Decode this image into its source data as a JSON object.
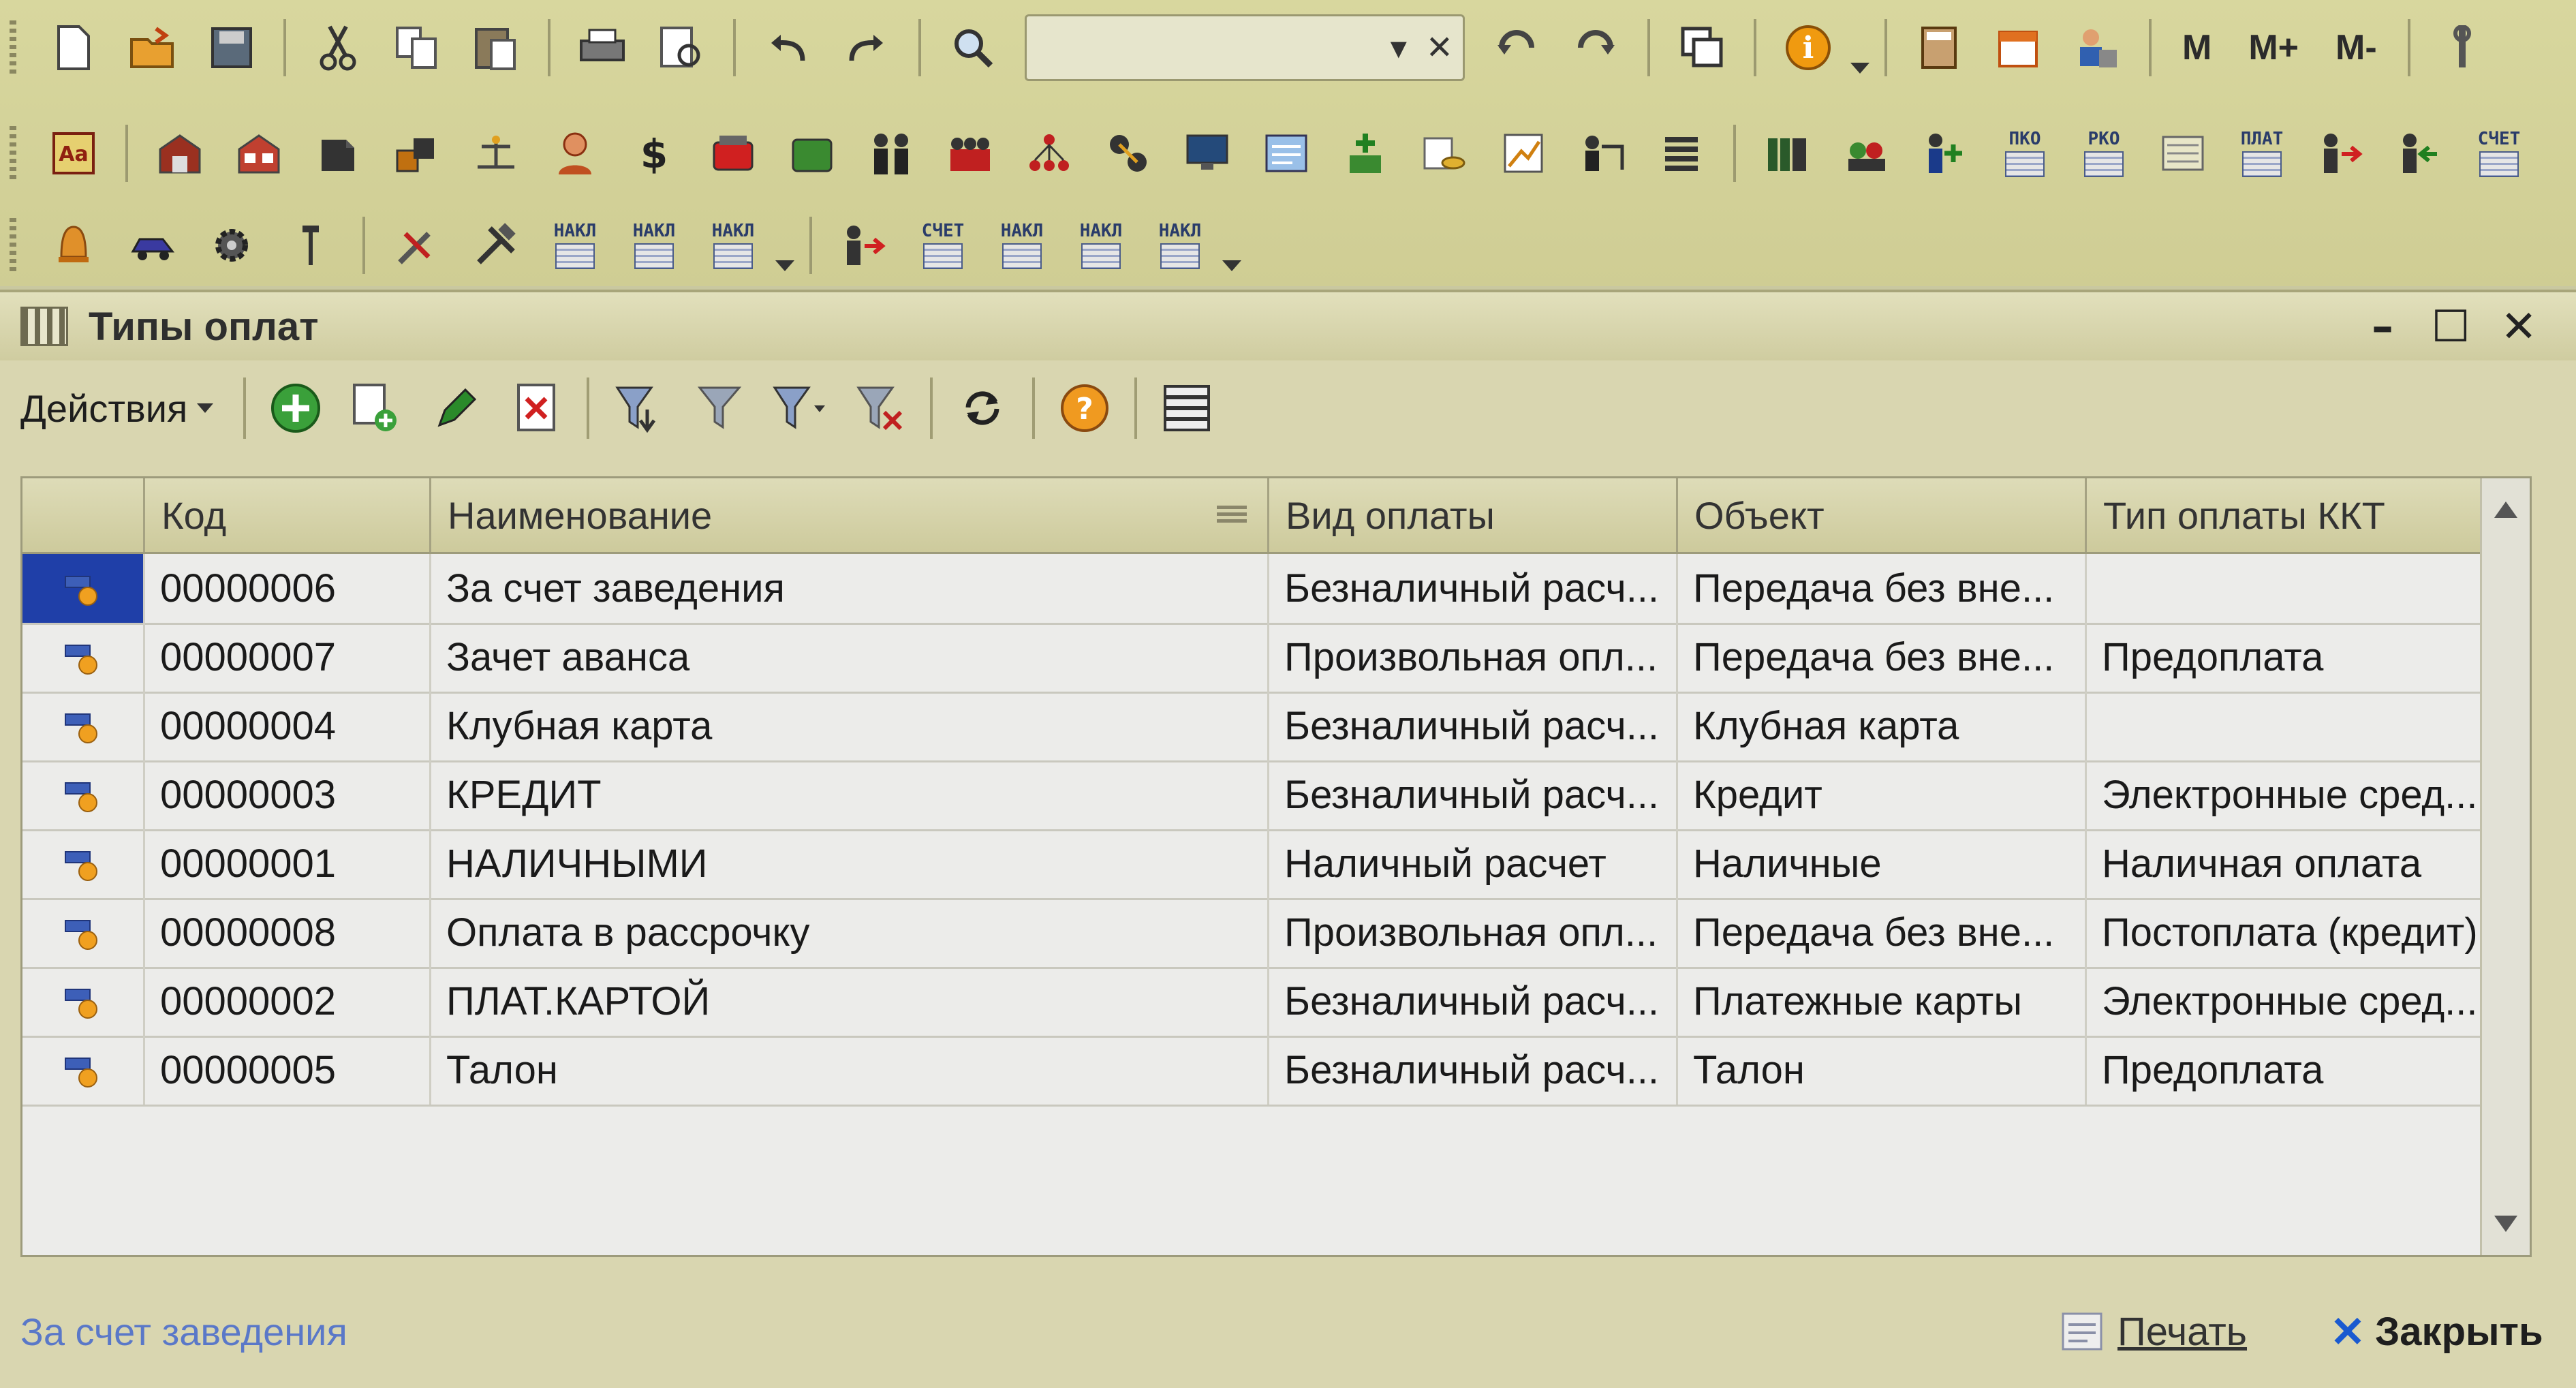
{
  "top_toolbar": {
    "row1": [
      "new-document",
      "open",
      "save",
      "cut",
      "copy",
      "paste",
      "print",
      "print-preview",
      "undo",
      "redo",
      "search",
      "history-back",
      "history-forward",
      "windows",
      "info",
      "calculator",
      "calendar",
      "users"
    ],
    "row1_text_buttons": [
      "M",
      "M+",
      "M-"
    ],
    "row2_small_labels": [
      "ПКО",
      "РКО",
      "ПЛАТ",
      "СЧЕТ"
    ],
    "row3_small_labels": [
      "НАКЛ",
      "НАКЛ",
      "НАКЛ",
      "СЧЕТ",
      "НАКЛ",
      "НАКЛ",
      "НАКЛ"
    ],
    "search_value": ""
  },
  "window": {
    "title": "Типы оплат",
    "actions_label": "Действия"
  },
  "table": {
    "columns": [
      "",
      "Код",
      "Наименование",
      "Вид оплаты",
      "Объект",
      "Тип оплаты ККТ"
    ],
    "rows": [
      {
        "code": "00000006",
        "name": "За счет заведения",
        "kind": "Безналичный расч...",
        "object": "Передача без вне...",
        "kkt": ""
      },
      {
        "code": "00000007",
        "name": "Зачет аванса",
        "kind": "Произвольная опл...",
        "object": "Передача без вне...",
        "kkt": "Предоплата"
      },
      {
        "code": "00000004",
        "name": "Клубная карта",
        "kind": "Безналичный расч...",
        "object": "Клубная карта",
        "kkt": ""
      },
      {
        "code": "00000003",
        "name": "КРЕДИТ",
        "kind": "Безналичный расч...",
        "object": "Кредит",
        "kkt": "Электронные сред..."
      },
      {
        "code": "00000001",
        "name": "НАЛИЧНЫМИ",
        "kind": "Наличный расчет",
        "object": "Наличные",
        "kkt": "Наличная оплата"
      },
      {
        "code": "00000008",
        "name": "Оплата в рассрочку",
        "kind": "Произвольная опл...",
        "object": "Передача без вне...",
        "kkt": "Постоплата (кредит)"
      },
      {
        "code": "00000002",
        "name": "ПЛАТ.КАРТОЙ",
        "kind": "Безналичный расч...",
        "object": "Платежные карты",
        "kkt": "Электронные сред..."
      },
      {
        "code": "00000005",
        "name": "Талон",
        "kind": "Безналичный расч...",
        "object": "Талон",
        "kkt": "Предоплата"
      }
    ],
    "selected_index": 0
  },
  "status": {
    "current_item": "За счет заведения",
    "print_label": "Печать",
    "close_label": "Закрыть"
  },
  "colors": {
    "toolbar_bg": "#d6d59c",
    "window_bg": "#d9d6b0",
    "selection": "#1f3fa8",
    "status_text": "#5a78c8"
  }
}
